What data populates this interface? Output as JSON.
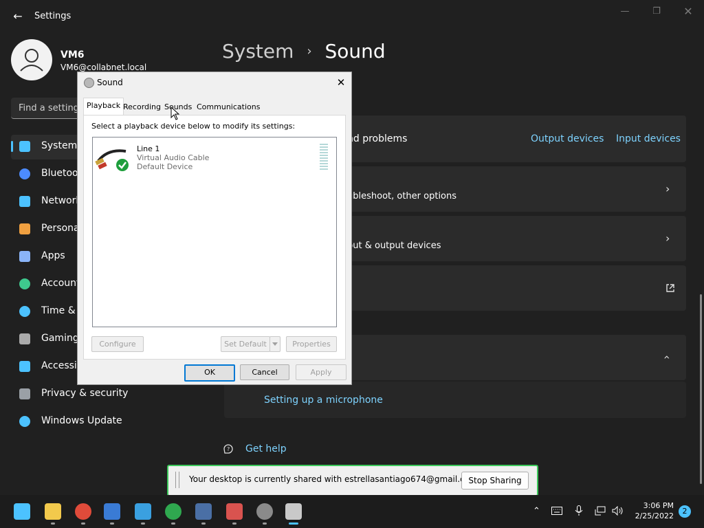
{
  "window": {
    "title": "Settings"
  },
  "user": {
    "name": "VM6",
    "email": "VM6@collabnet.local"
  },
  "search": {
    "placeholder": "Find a setting"
  },
  "nav": [
    {
      "label": "System",
      "icon": "monitor-icon",
      "active": true
    },
    {
      "label": "Bluetooth & devices",
      "icon": "bluetooth-icon"
    },
    {
      "label": "Network & internet",
      "icon": "wifi-icon"
    },
    {
      "label": "Personalization",
      "icon": "brush-icon"
    },
    {
      "label": "Apps",
      "icon": "apps-icon"
    },
    {
      "label": "Accounts",
      "icon": "person-icon"
    },
    {
      "label": "Time & language",
      "icon": "clock-icon"
    },
    {
      "label": "Gaming",
      "icon": "gamepad-icon"
    },
    {
      "label": "Accessibility",
      "icon": "accessibility-icon"
    },
    {
      "label": "Privacy & security",
      "icon": "shield-icon"
    },
    {
      "label": "Windows Update",
      "icon": "update-icon"
    }
  ],
  "breadcrumb": {
    "parent": "System",
    "separator": "›",
    "current": "Sound"
  },
  "cards": {
    "troubleshoot": {
      "text": "Troubleshoot common sound problems",
      "visible_text": "nd problems",
      "links": [
        "Output devices",
        "Input devices"
      ]
    },
    "all_devices": {
      "visible_text": "ubleshoot, other options"
    },
    "volume_mixer": {
      "visible_text": "put & output devices"
    },
    "help_link": "Setting up a microphone"
  },
  "get_help": "Get help",
  "dialog": {
    "title": "Sound",
    "tabs": [
      "Playback",
      "Recording",
      "Sounds",
      "Communications"
    ],
    "selected_tab": "Playback",
    "instruction": "Select a playback device below to modify its settings:",
    "device": {
      "name": "Line 1",
      "description": "Virtual Audio Cable",
      "status": "Default Device"
    },
    "buttons": {
      "configure": "Configure",
      "set_default": "Set Default",
      "properties": "Properties",
      "ok": "OK",
      "cancel": "Cancel",
      "apply": "Apply"
    }
  },
  "share_bar": {
    "message": "Your desktop is currently shared with estrellasantiago674@gmail.com",
    "stop_button": "Stop Sharing"
  },
  "taskbar": {
    "time": "3:06 PM",
    "date": "2/25/2022",
    "notification_count": "2",
    "apps": [
      "start-icon",
      "file-explorer-icon",
      "chrome-icon",
      "virtualbox-icon",
      "edge-icon",
      "chrome-profile-icon",
      "snip-icon",
      "paint-icon",
      "settings-icon",
      "sound-app-icon"
    ]
  },
  "colors": {
    "accent": "#4cc2ff",
    "link": "#7ed3ff",
    "share_border": "#3cc85a",
    "dialog_default_button": "#0078d4"
  }
}
